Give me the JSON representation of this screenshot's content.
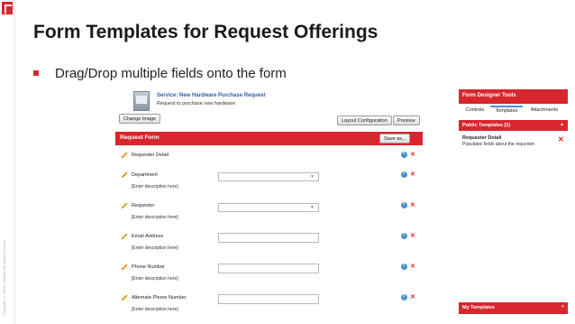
{
  "slide": {
    "title": "Form Templates for Request Offerings",
    "bullet": "Drag/Drop multiple fields onto the form",
    "copyright": "Copyright © 2013 Landesk. All rights reserved."
  },
  "service": {
    "title": "Service: New Hardware Purchase Request",
    "description": "Request to purchase new hardware.",
    "change_image_label": "Change Image"
  },
  "toolbar": {
    "layout_label": "Layout Configuration",
    "preview_label": "Preview"
  },
  "form": {
    "header_title": "Request Form",
    "save_label": "Save as...",
    "fields": [
      {
        "label": "Requester Detail",
        "description": "",
        "control": "none"
      },
      {
        "label": "Department",
        "description": "[Enter description here]",
        "control": "select"
      },
      {
        "label": "Requestor",
        "description": "[Enter description here]",
        "control": "select"
      },
      {
        "label": "Email Address",
        "description": "[Enter description here]",
        "control": "text"
      },
      {
        "label": "Phone Number",
        "description": "[Enter description here]",
        "control": "text"
      },
      {
        "label": "Alternate Phone Number",
        "description": "[Enter description here]",
        "control": "text"
      }
    ]
  },
  "designer": {
    "title": "Form Designer Tools",
    "tabs": [
      "Controls",
      "Templates",
      "Attachments"
    ],
    "active_tab": "Templates",
    "public_section": "Public Templates (1)",
    "template_name": "Requester Detail",
    "template_desc": "Populates fields about the requester.",
    "my_templates": "My Templates"
  },
  "icons": {
    "edit": "pencil-icon",
    "info": "info-icon",
    "remove": "close-icon",
    "collapse": "chevron-up-icon",
    "expand": "double-chevron-up-icon"
  },
  "colors": {
    "accent": "#d8262f",
    "link": "#2a5fa8",
    "info": "#4d8fd6"
  }
}
